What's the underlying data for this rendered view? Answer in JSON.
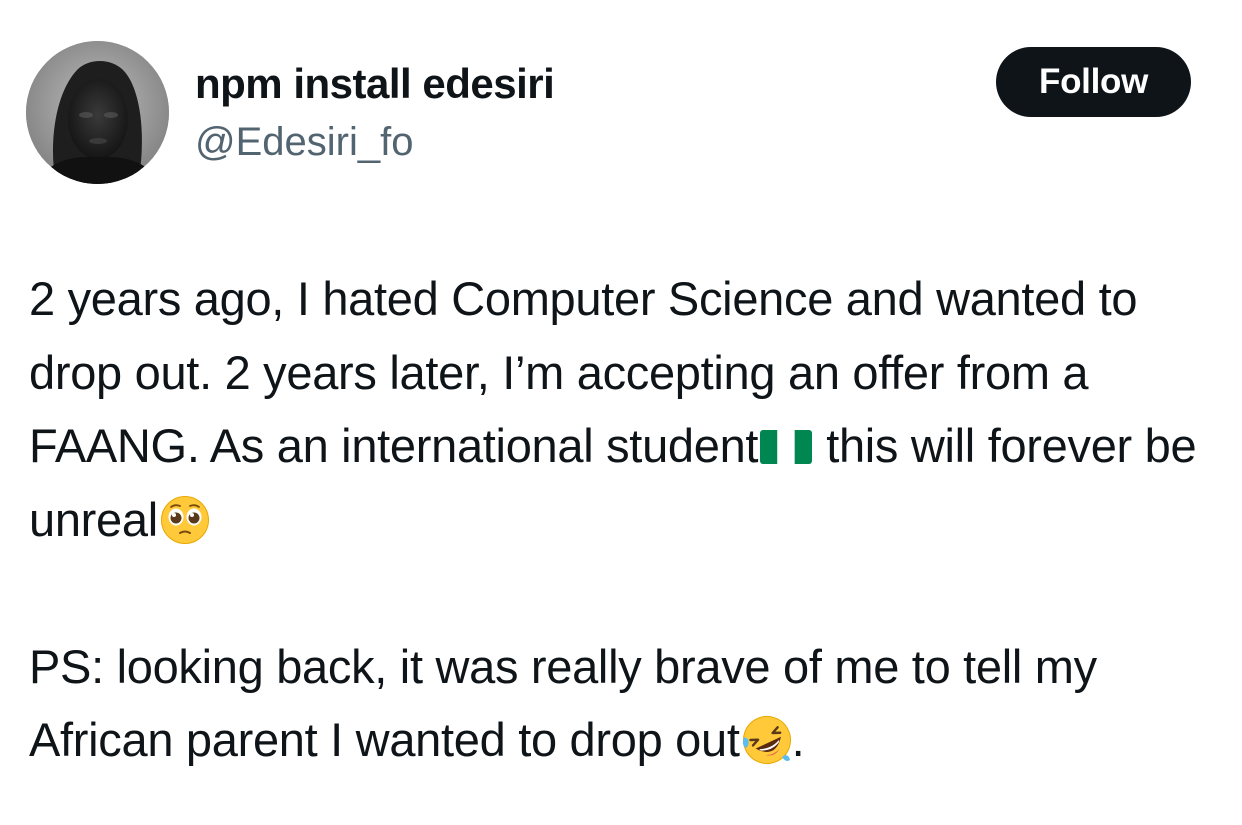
{
  "user": {
    "display_name": "npm install edesiri",
    "handle": "@Edesiri_fo",
    "avatar": "profile-photo"
  },
  "actions": {
    "follow_label": "Follow"
  },
  "tweet": {
    "paragraph1": {
      "text_before_flag": "2 years ago, I hated Computer Science and wanted to drop out. 2 years later, I’m accepting an offer from a FAANG. As an international student",
      "flag_icon": "nigeria-flag-emoji",
      "text_after_flag": "this will forever be unreal",
      "end_icon": "pleading-face-emoji"
    },
    "paragraph2": {
      "text": "PS: looking back, it was really brave of me to tell my African parent I wanted to drop out",
      "end_icon": "rolling-on-floor-laughing-emoji",
      "end_punctuation": "."
    }
  },
  "colors": {
    "text": "#0f1419",
    "secondary_text": "#536471",
    "follow_button_bg": "#0f1419",
    "follow_button_text": "#ffffff",
    "nigeria_green": "#008751"
  }
}
